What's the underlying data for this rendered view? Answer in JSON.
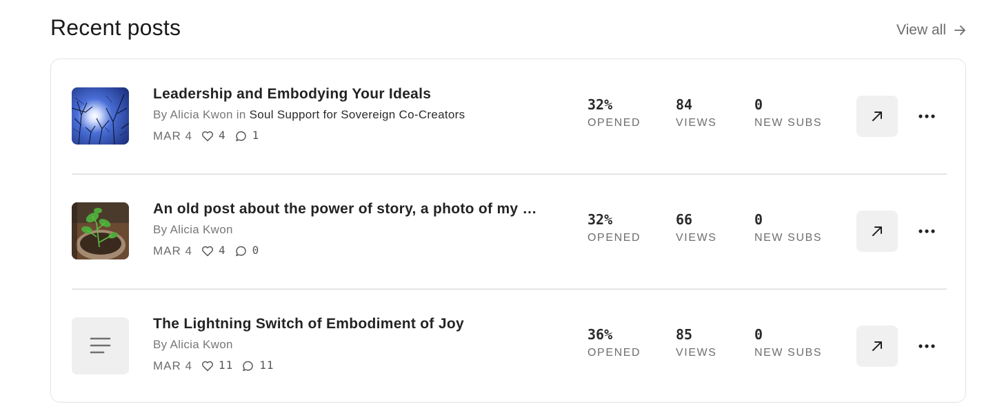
{
  "header": {
    "title": "Recent posts",
    "view_all_label": "View all"
  },
  "posts": [
    {
      "title": "Leadership and Embodying Your Ideals",
      "byline_prefix": "By ",
      "author": "Alicia Kwon",
      "byline_in": " in ",
      "publication": "Soul Support for Sovereign Co-Creators",
      "date": "MAR 4",
      "likes": "4",
      "comments": "1",
      "opened_value": "32%",
      "opened_label": "OPENED",
      "views_value": "84",
      "views_label": "VIEWS",
      "subs_value": "0",
      "subs_label": "NEW SUBS",
      "thumbnail": "trees-sun-photo"
    },
    {
      "title": "An old post about the power of story, a photo of my pota…",
      "byline_prefix": "By ",
      "author": "Alicia Kwon",
      "date": "MAR 4",
      "likes": "4",
      "comments": "0",
      "opened_value": "32%",
      "opened_label": "OPENED",
      "views_value": "66",
      "views_label": "VIEWS",
      "subs_value": "0",
      "subs_label": "NEW SUBS",
      "thumbnail": "potted-plant-photo"
    },
    {
      "title": "The Lightning Switch of Embodiment of Joy",
      "byline_prefix": "By ",
      "author": "Alicia Kwon",
      "date": "MAR 4",
      "likes": "11",
      "comments": "11",
      "opened_value": "36%",
      "opened_label": "OPENED",
      "views_value": "85",
      "views_label": "VIEWS",
      "subs_value": "0",
      "subs_label": "NEW SUBS",
      "thumbnail": "text-lines-icon"
    }
  ],
  "colors": {
    "card_border": "#e3e3e3",
    "muted_text": "#6b6b6b",
    "button_bg": "#f0f0f0"
  }
}
